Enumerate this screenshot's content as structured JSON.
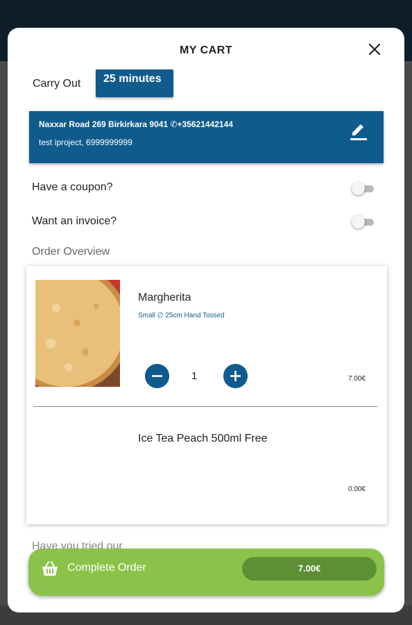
{
  "header": {
    "title": "MY CART"
  },
  "delivery": {
    "mode": "Carry Out",
    "time": "25 minutes"
  },
  "address": {
    "line": "Naxxar Road 269 Birkirkara 9041 ✆+35621442144",
    "contact": "test iproject, 6999999999"
  },
  "options": {
    "coupon": "Have a coupon?",
    "invoice": "Want an invoice?",
    "coupon_on": false,
    "invoice_on": false
  },
  "order": {
    "section_title": "Order Overview",
    "items": [
      {
        "name": "Margherita",
        "desc": "Small ∅ 25cm Hand Tossed",
        "qty": "1",
        "price": "7.00€"
      },
      {
        "name": "Ice Tea Peach 500ml Free",
        "price": "0.00€"
      }
    ]
  },
  "upsell": {
    "partial_text": "Have you tried our"
  },
  "footer": {
    "complete_label": "Complete Order",
    "total": "7.00€"
  },
  "colors": {
    "primary": "#0f5b8c",
    "accent_green": "#8bc34a",
    "dark_green": "#5d8f34",
    "topbar": "#0e1f2b"
  }
}
